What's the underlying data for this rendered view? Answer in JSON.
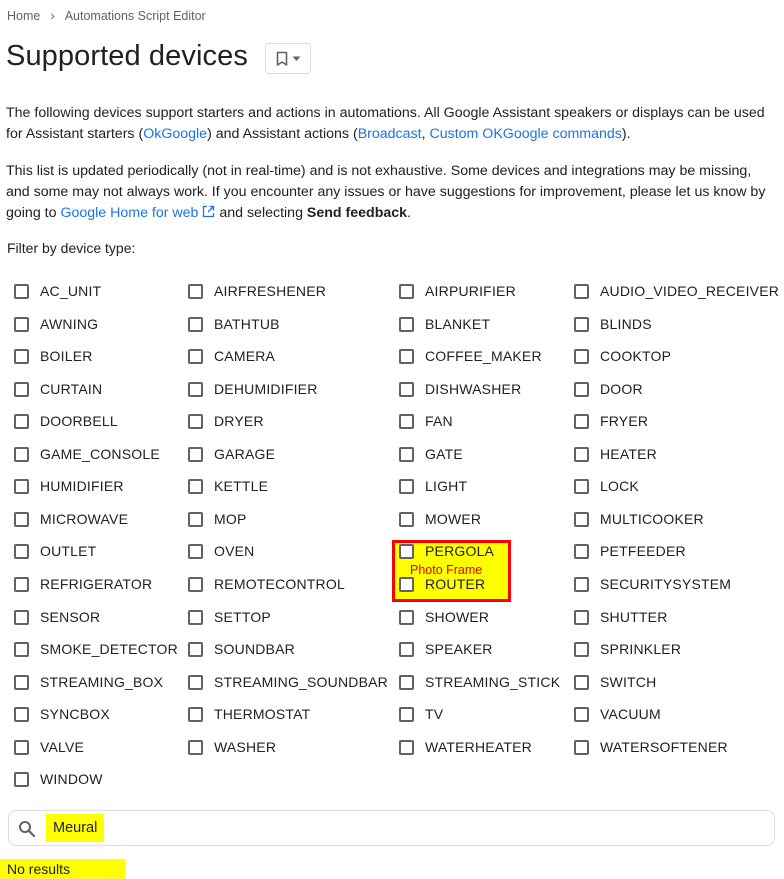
{
  "breadcrumb": {
    "home": "Home",
    "current": "Automations Script Editor"
  },
  "page": {
    "title": "Supported devices"
  },
  "intro": {
    "t1": "The following devices support starters and actions in automations. All Google Assistant speakers or displays can be used for Assistant starters (",
    "link_ok": "OkGoogle",
    "t2": ") and Assistant actions (",
    "link_broadcast": "Broadcast",
    "t3": ", ",
    "link_custom": "Custom OKGoogle commands",
    "t4": ")."
  },
  "notice": {
    "t1": "This list is updated periodically (not in real-time) and is not exhaustive. Some devices and integrations may be missing, and some may not always work. If you encounter any issues or have suggestions for improvement, please let us know by going to ",
    "link": "Google Home for web",
    "t2": " and selecting ",
    "bold": "Send feedback",
    "t3": "."
  },
  "filter": {
    "label": "Filter by device type:",
    "options": [
      "AC_UNIT",
      "AIRFRESHENER",
      "AIRPURIFIER",
      "AUDIO_VIDEO_RECEIVER",
      "AWNING",
      "BATHTUB",
      "BLANKET",
      "BLINDS",
      "BOILER",
      "CAMERA",
      "COFFEE_MAKER",
      "COOKTOP",
      "CURTAIN",
      "DEHUMIDIFIER",
      "DISHWASHER",
      "DOOR",
      "DOORBELL",
      "DRYER",
      "FAN",
      "FRYER",
      "GAME_CONSOLE",
      "GARAGE",
      "GATE",
      "HEATER",
      "HUMIDIFIER",
      "KETTLE",
      "LIGHT",
      "LOCK",
      "MICROWAVE",
      "MOP",
      "MOWER",
      "MULTICOOKER",
      "OUTLET",
      "OVEN",
      "PERGOLA",
      "PETFEEDER",
      "REFRIGERATOR",
      "REMOTECONTROL",
      "ROUTER",
      "SECURITYSYSTEM",
      "SENSOR",
      "SETTOP",
      "SHOWER",
      "SHUTTER",
      "SMOKE_DETECTOR",
      "SOUNDBAR",
      "SPEAKER",
      "SPRINKLER",
      "STREAMING_BOX",
      "STREAMING_SOUNDBAR",
      "STREAMING_STICK",
      "SWITCH",
      "SYNCBOX",
      "THERMOSTAT",
      "TV",
      "VACUUM",
      "VALVE",
      "WASHER",
      "WATERHEATER",
      "WATERSOFTENER",
      "WINDOW"
    ]
  },
  "annotation": {
    "text": "Photo Frame",
    "border_color": "#ff0000",
    "fill_color": "#ffff00"
  },
  "search": {
    "value": "Meural",
    "icon": "search-icon"
  },
  "results": {
    "message": "No results"
  },
  "colors": {
    "link": "#1a73e8",
    "highlight": "#ffff00"
  }
}
